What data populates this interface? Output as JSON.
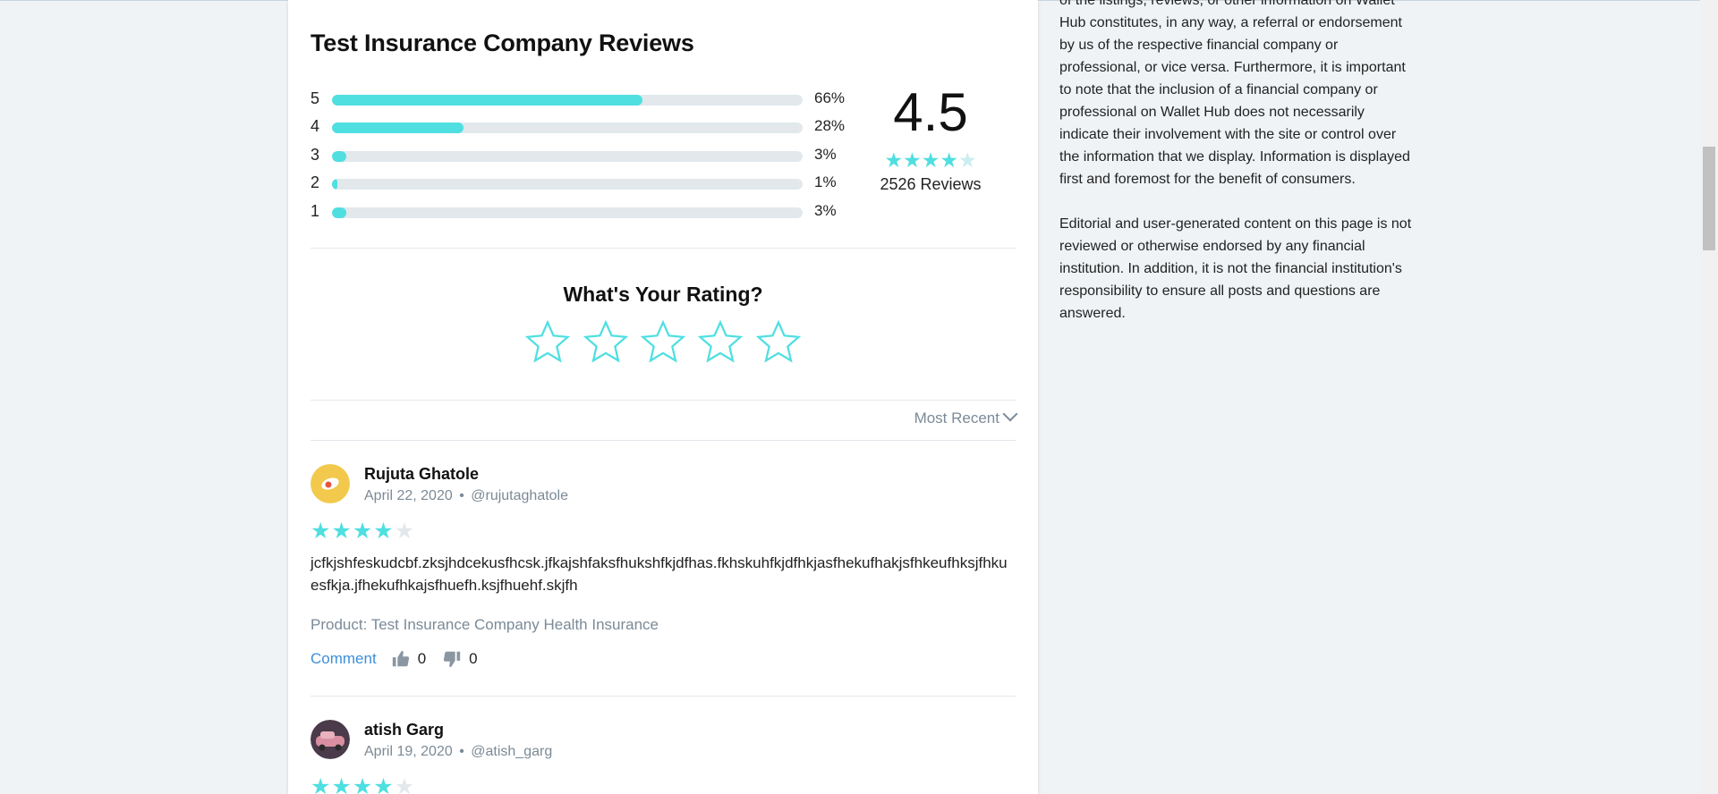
{
  "company_reviews": {
    "title": "Test Insurance Company Reviews",
    "distribution": [
      {
        "stars": "5",
        "percent_label": "66%",
        "fraction": 0.66
      },
      {
        "stars": "4",
        "percent_label": "28%",
        "fraction": 0.28
      },
      {
        "stars": "3",
        "percent_label": "3%",
        "fraction": 0.03
      },
      {
        "stars": "2",
        "percent_label": "1%",
        "fraction": 0.01
      },
      {
        "stars": "1",
        "percent_label": "3%",
        "fraction": 0.03
      }
    ],
    "average_score": "4.5",
    "average_stars": 4.5,
    "reviews_count": "2526 Reviews"
  },
  "rate_prompt": {
    "title": "What's Your Rating?",
    "stars_count": 5
  },
  "sort": {
    "label": "Most Recent"
  },
  "reviews": [
    {
      "name": "Rujuta Ghatole",
      "date": "April 22, 2020",
      "separator": "•",
      "handle": "@rujutaghatole",
      "rating": 4,
      "text": "jcfkjshfeskudcbf.zksjhdcekusfhcsk.jfkajshfaksfhukshfkjdfhas.fkhskuhfkjdfhkjasfhekufhakjsfhkeufhksjfhkuesfkja.jfhekufhkajsfhuefh.ksjfhuehf.skjfh",
      "product": "Product: Test Insurance Company Health Insurance",
      "comment_label": "Comment",
      "upvotes": "0",
      "downvotes": "0"
    },
    {
      "name": "atish Garg",
      "date": "April 19, 2020",
      "separator": "•",
      "handle": "@atish_garg",
      "rating": 4
    }
  ],
  "sidebar": {
    "paragraph_1": "of the listings, reviews, or other information on Wallet Hub constitutes, in any way, a referral or endorsement by us of the respective financial company or professional, or vice versa. Furthermore, it is important to note that the inclusion of a financial company or professional on Wallet Hub does not necessarily indicate their involvement with the site or control over the information that we display. Information is displayed first and foremost for the benefit of consumers.",
    "paragraph_2": "Editorial and user-generated content on this page is not reviewed or otherwise endorsed by any financial institution. In addition, it is not the financial institution's responsibility to ensure all posts and questions are answered."
  },
  "colors": {
    "accent": "#4fdfe1",
    "link": "#3d8fd8",
    "muted": "#7b8a97",
    "page_background": "#eff3f6"
  },
  "icons": [
    "star-icon",
    "thumbs-up-icon",
    "thumbs-down-icon",
    "chevron-down-icon"
  ]
}
